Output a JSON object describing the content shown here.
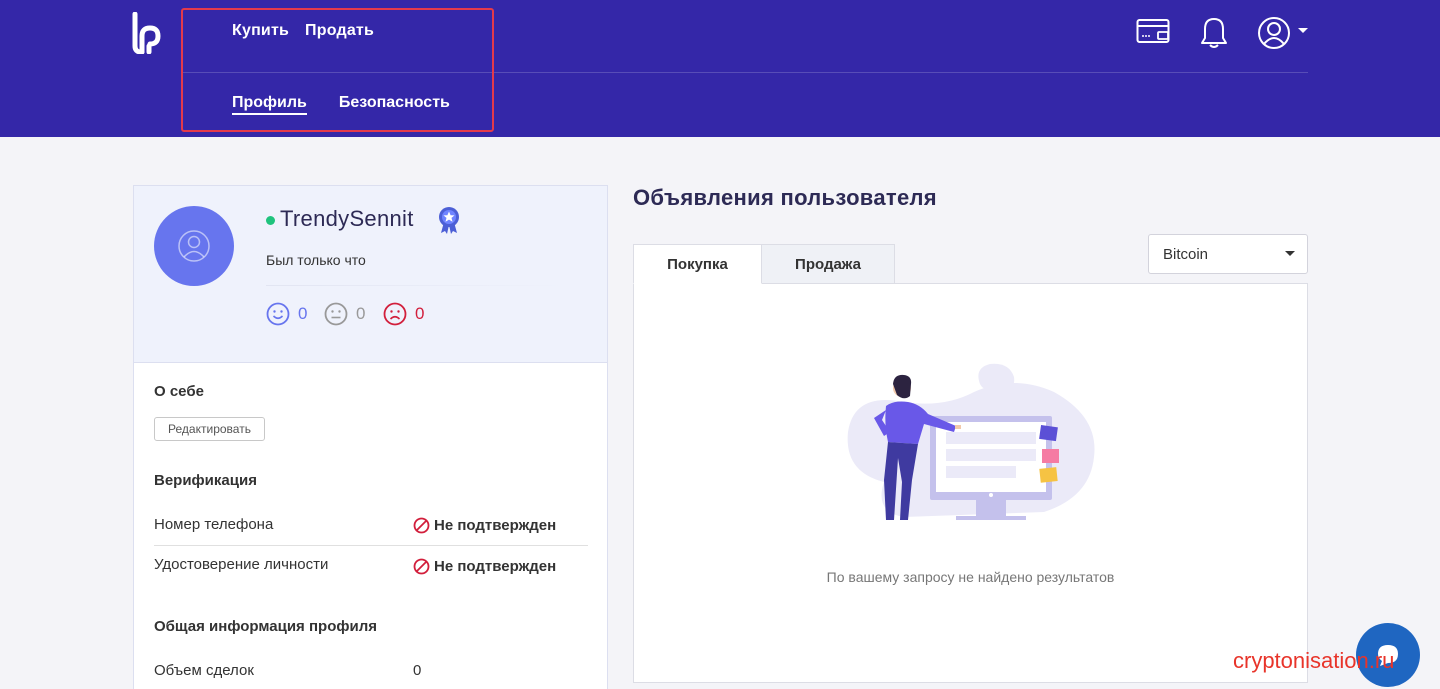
{
  "nav": {
    "top": [
      "Купить",
      "Продать"
    ],
    "bottom": [
      "Профиль",
      "Безопасность"
    ],
    "active_bottom": "Профиль"
  },
  "header_icons": [
    "wallet-icon",
    "bell-icon",
    "user-circle-icon",
    "caret-down-icon"
  ],
  "profile": {
    "username": "TrendySennit",
    "online": true,
    "last_seen": "Был только что",
    "ratings": {
      "positive": "0",
      "neutral": "0",
      "negative": "0"
    }
  },
  "about": {
    "title": "О себе",
    "edit_label": "Редактировать"
  },
  "verification": {
    "title": "Верификация",
    "items": [
      {
        "label": "Номер телефона",
        "status": "Не подтвержден"
      },
      {
        "label": "Удостоверение личности",
        "status": "Не подтвержден"
      }
    ]
  },
  "general": {
    "title": "Общая информация профиля",
    "items": [
      {
        "label": "Объем сделок",
        "value": "0"
      }
    ]
  },
  "ads": {
    "title": "Объявления пользователя",
    "tabs": [
      "Покупка",
      "Продажа"
    ],
    "active_tab": "Покупка",
    "currency_select": "Bitcoin",
    "empty_message": "По вашему запросу не найдено результатов"
  },
  "watermark": "cryptonisation.ru",
  "colors": {
    "header_bg": "#3427a8",
    "accent": "#6775ee",
    "online": "#1fc37d",
    "negative": "#d21f3c",
    "highlight": "#e33a4b"
  }
}
